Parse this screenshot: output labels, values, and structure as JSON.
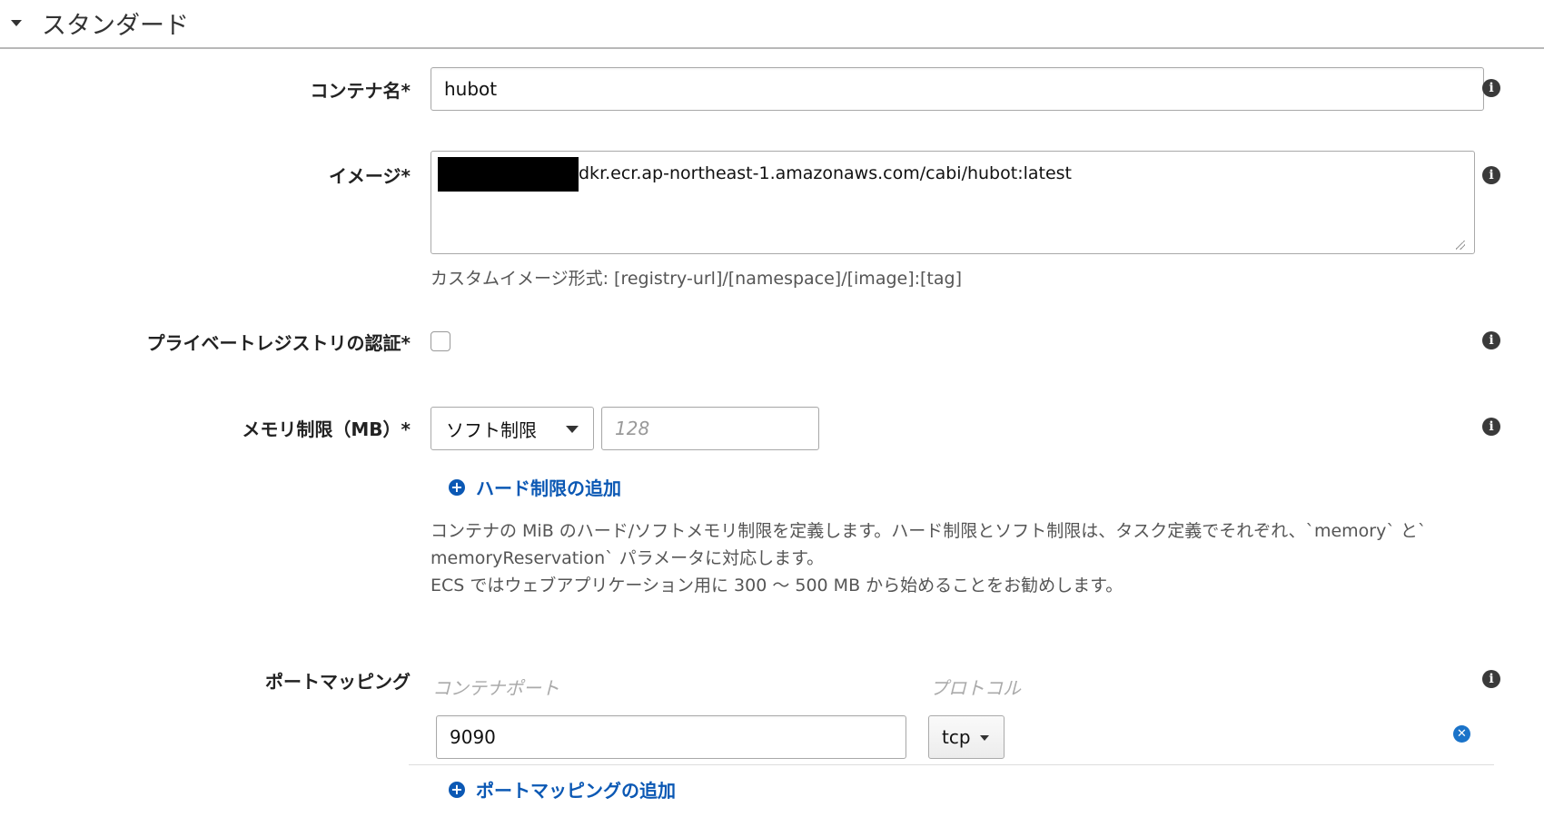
{
  "section": {
    "title": "スタンダード"
  },
  "container_name": {
    "label": "コンテナ名*",
    "value": "hubot"
  },
  "image": {
    "label": "イメージ*",
    "value": "dkr.ecr.ap-northeast-1.amazonaws.com/cabi/hubot:latest",
    "hint": "カスタムイメージ形式: [registry-url]/[namespace]/[image]:[tag]"
  },
  "private_registry": {
    "label": "プライベートレジストリの認証*",
    "checked": false
  },
  "memory": {
    "label": "メモリ制限（MB）*",
    "select_value": "ソフト制限",
    "placeholder": "128",
    "add_hard_limit": "ハード制限の追加",
    "help_line1": "コンテナの MiB のハード/ソフトメモリ制限を定義します。ハード制限とソフト制限は、タスク定義でそれぞれ、`memory` と`",
    "help_line2": "memoryReservation` パラメータに対応します。",
    "help_line3": "ECS ではウェブアプリケーション用に 300 〜 500 MB から始めることをお勧めします。"
  },
  "port_mapping": {
    "label": "ポートマッピング",
    "col_container_port": "コンテナポート",
    "col_protocol": "プロトコル",
    "rows": [
      {
        "container_port": "9090",
        "protocol": "tcp"
      }
    ],
    "add_label": "ポートマッピングの追加"
  },
  "icons": {
    "info": "info-icon",
    "caret": "caret-down-icon",
    "plus": "plus-circle-icon",
    "remove": "remove-circle-icon"
  },
  "colors": {
    "link": "#0b58b4",
    "remove": "#1a73c9"
  }
}
